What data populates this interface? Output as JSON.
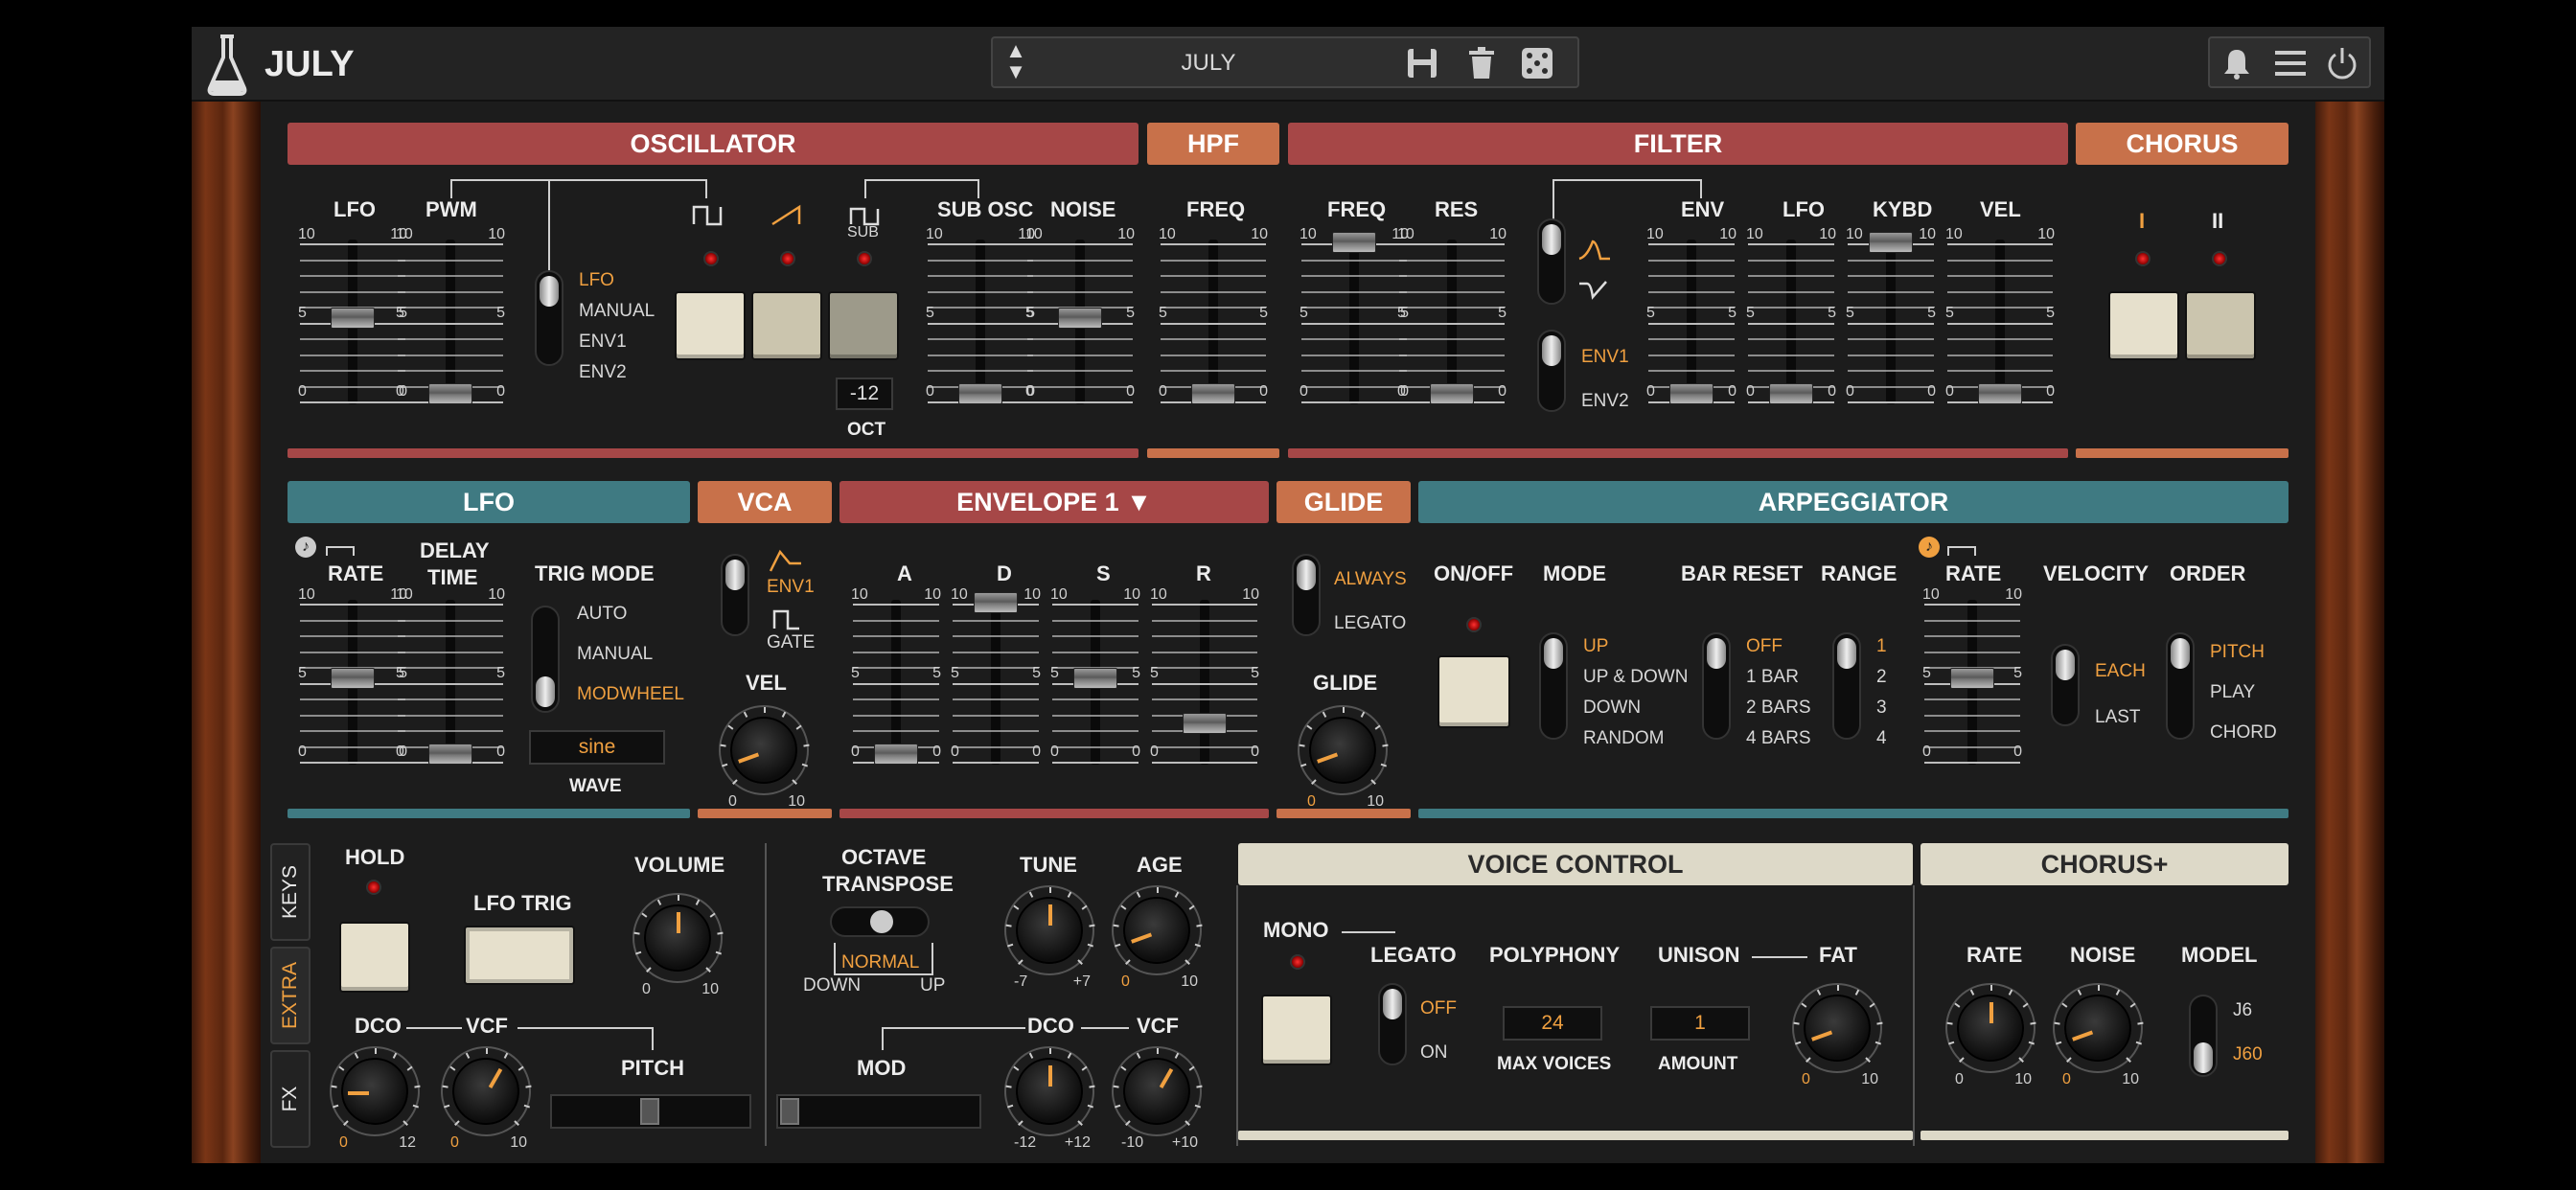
{
  "app": {
    "name": "JULY"
  },
  "preset": {
    "name": "JULY"
  },
  "oscillator": {
    "title": "OSCILLATOR",
    "lfo": "LFO",
    "pwm": "PWM",
    "sub_osc": "SUB OSC",
    "noise": "NOISE",
    "sub": "SUB",
    "pwm_src": [
      "LFO",
      "MANUAL",
      "ENV1",
      "ENV2"
    ],
    "oct": "OCT",
    "oct_val": "-12"
  },
  "hpf": {
    "title": "HPF",
    "freq": "FREQ"
  },
  "filter": {
    "title": "FILTER",
    "freq": "FREQ",
    "res": "RES",
    "env": "ENV",
    "lfo": "LFO",
    "kybd": "KYBD",
    "vel": "VEL",
    "env1": "ENV1",
    "env2": "ENV2"
  },
  "chorus": {
    "title": "CHORUS",
    "i": "I",
    "ii": "II"
  },
  "lfo": {
    "title": "LFO",
    "rate": "RATE",
    "delay": "DELAY",
    "time": "TIME",
    "trig_mode": "TRIG MODE",
    "modes": [
      "AUTO",
      "MANUAL",
      "MODWHEEL"
    ],
    "wave": "WAVE",
    "wave_val": "sine"
  },
  "vca": {
    "title": "VCA",
    "env1": "ENV1",
    "gate": "GATE",
    "vel": "VEL"
  },
  "env1": {
    "title": "ENVELOPE 1",
    "a": "A",
    "d": "D",
    "s": "S",
    "r": "R"
  },
  "glide": {
    "title": "GLIDE",
    "always": "ALWAYS",
    "legato": "LEGATO",
    "glide": "GLIDE"
  },
  "arp": {
    "title": "ARPEGGIATOR",
    "onoff": "ON/OFF",
    "mode": "MODE",
    "modes": [
      "UP",
      "UP & DOWN",
      "DOWN",
      "RANDOM"
    ],
    "bar_reset": "BAR RESET",
    "bars": [
      "OFF",
      "1 BAR",
      "2 BARS",
      "4 BARS"
    ],
    "range": "RANGE",
    "ranges": [
      "1",
      "2",
      "3",
      "4"
    ],
    "rate": "RATE",
    "velocity": "VELOCITY",
    "vel_opts": [
      "EACH",
      "LAST"
    ],
    "order": "ORDER",
    "orders": [
      "PITCH",
      "PLAY",
      "CHORD"
    ]
  },
  "ticks": {
    "t0": "0",
    "t5": "5",
    "t10": "10",
    "t12": "12",
    "m7": "-7",
    "p7": "+7",
    "m12": "-12",
    "p12": "+12",
    "m10": "-10",
    "p10": "+10"
  },
  "tabs": [
    "KEYS",
    "EXTRA",
    "FX"
  ],
  "extra": {
    "hold": "HOLD",
    "lfo_trig": "LFO TRIG",
    "volume": "VOLUME",
    "dco": "DCO",
    "vcf": "VCF",
    "pitch": "PITCH",
    "octave": "OCTAVE",
    "transpose": "TRANSPOSE",
    "normal": "NORMAL",
    "down": "DOWN",
    "up": "UP",
    "tune": "TUNE",
    "age": "AGE",
    "mod": "MOD"
  },
  "voice": {
    "title": "VOICE CONTROL",
    "mono": "MONO",
    "legato": "LEGATO",
    "off": "OFF",
    "on": "ON",
    "polyphony": "POLYPHONY",
    "poly_val": "24",
    "max_voices": "MAX VOICES",
    "unison": "UNISON",
    "unison_val": "1",
    "amount": "AMOUNT",
    "fat": "FAT"
  },
  "chorusplus": {
    "title": "CHORUS+",
    "rate": "RATE",
    "noise": "NOISE",
    "model": "MODEL",
    "j6": "J6",
    "j60": "J60"
  },
  "colors": {
    "red": "#a64747",
    "orange": "#c8714a",
    "teal": "#3f7a82",
    "accent": "#f0a040"
  }
}
